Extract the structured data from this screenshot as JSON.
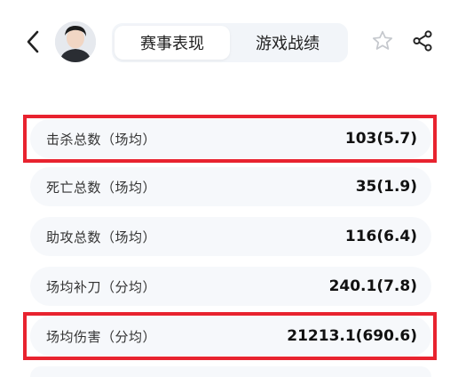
{
  "header": {
    "tabs": [
      {
        "label": "赛事表现",
        "active": true
      },
      {
        "label": "游戏战绩",
        "active": false
      }
    ],
    "icons": {
      "back": "chevron-left-icon",
      "star": "star-outline-icon",
      "share": "share-icon"
    }
  },
  "stats": [
    {
      "label": "击杀总数（场均）",
      "value": "103(5.7)",
      "highlighted": true
    },
    {
      "label": "死亡总数（场均）",
      "value": "35(1.9)",
      "highlighted": false
    },
    {
      "label": "助攻总数（场均）",
      "value": "116(6.4)",
      "highlighted": false
    },
    {
      "label": "场均补刀（分均）",
      "value": "240.1(7.8)",
      "highlighted": false
    },
    {
      "label": "场均伤害（分均）",
      "value": "21213.1(690.6)",
      "highlighted": true
    }
  ],
  "colors": {
    "highlight": "#e8232f",
    "row_bg": "#f6f8fb",
    "tab_bg": "#f2f5f9"
  }
}
